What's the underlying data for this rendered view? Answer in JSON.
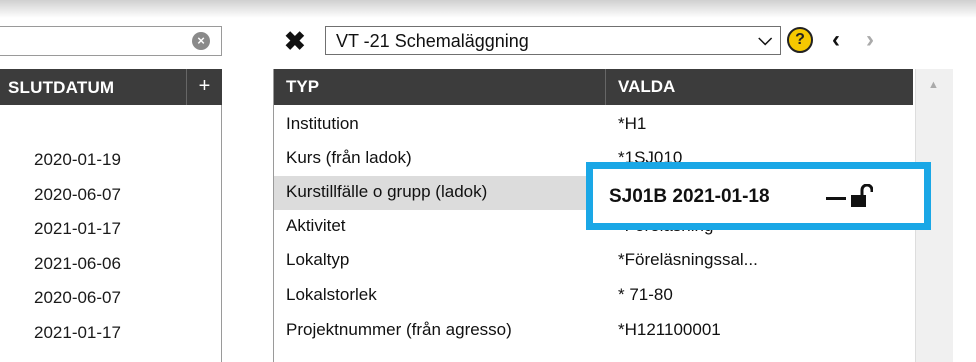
{
  "left_panel": {
    "clear_icon": "x-circle-icon",
    "header": {
      "title": "SLUTDATUM",
      "add_label": "+"
    },
    "dates": [
      "2020-01-19",
      "2020-06-07",
      "2021-01-17",
      "2021-06-06",
      "2020-06-07",
      "2021-01-17"
    ]
  },
  "toolbar": {
    "close_icon": "close-x-icon",
    "schedule_value": "VT -21 Schemaläggning",
    "dropdown_icon": "chevron-down-icon",
    "help_label": "?",
    "prev_label": "‹",
    "next_label": "›"
  },
  "table": {
    "headers": {
      "typ": "TYP",
      "valda": "VALDA"
    },
    "rows": [
      {
        "typ": "Institution",
        "valda": "*H1"
      },
      {
        "typ": "Kurs (från ladok)",
        "valda": "*1SJ010"
      },
      {
        "typ": "Kurstillfälle o grupp (ladok)",
        "valda": "SJ01B 2021-01-18"
      },
      {
        "typ": "Aktivitet",
        "valda": "*Föreläsning"
      },
      {
        "typ": "Lokaltyp",
        "valda": "*Föreläsningssal..."
      },
      {
        "typ": "Lokalstorlek",
        "valda": "* 71-80"
      },
      {
        "typ": "Projektnummer (från agresso)",
        "valda": "*H121100001"
      }
    ],
    "selected_row_index": 2
  },
  "colors": {
    "header_bg": "#3c3c3c",
    "highlight_border": "#1aa7e6",
    "help_yellow": "#f5c800"
  }
}
